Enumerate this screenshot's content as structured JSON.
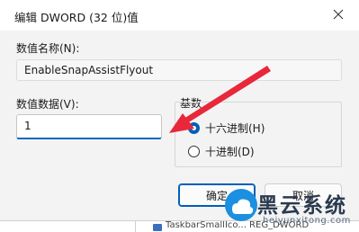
{
  "dialog": {
    "title": "编辑 DWORD (32 位)值",
    "value_name_label": "数值名称(N):",
    "value_name": "EnableSnapAssistFlyout",
    "value_data_label": "数值数据(V):",
    "value_data": "1",
    "base_group_label": "基数",
    "base_options": [
      {
        "label": "十六进制(H)",
        "selected": true
      },
      {
        "label": "十进制(D)",
        "selected": false
      }
    ],
    "ok_label": "确定",
    "cancel_label": "取消"
  },
  "background_window": {
    "row_text": "TaskbarSmallIco... REG_DWORD"
  },
  "watermark": {
    "brand": "黑云系统",
    "url": "heiyunxitong.com"
  },
  "colors": {
    "accent": "#005fb8",
    "annotation_arrow": "#e8283a",
    "watermark_logo": "#1b8fe0"
  },
  "icons": [
    "close-icon",
    "radio-checked-icon",
    "radio-unchecked-icon",
    "annotation-arrow",
    "cloud-logo-icon"
  ]
}
